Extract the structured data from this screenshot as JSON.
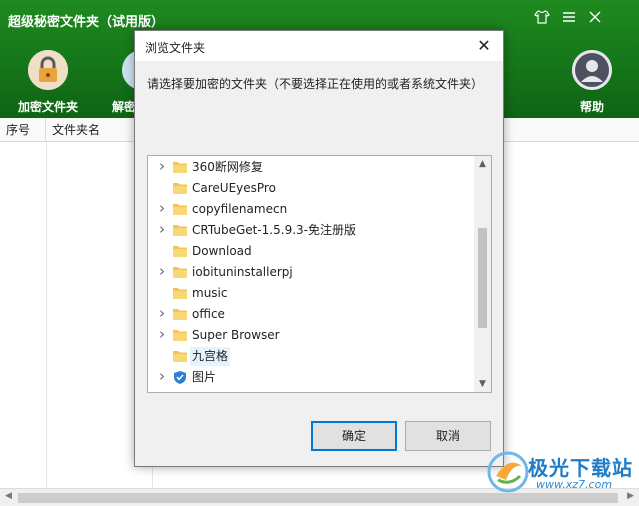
{
  "app": {
    "title": "超级秘密文件夹（试用版）",
    "toolbar": [
      {
        "label": "加密文件夹",
        "icon": "lock-icon"
      },
      {
        "label": "解密",
        "icon": "unlock-icon"
      },
      {
        "label": "帮助",
        "icon": "user-help-icon"
      }
    ],
    "window_controls": [
      "skin-icon",
      "menu-icon",
      "close-icon"
    ]
  },
  "table": {
    "columns": [
      "序号",
      "文件夹名"
    ]
  },
  "dialog": {
    "title": "浏览文件夹",
    "prompt": "请选择要加密的文件夹（不要选择正在使用的或者系统文件夹）",
    "ok_label": "确定",
    "cancel_label": "取消",
    "tree": [
      {
        "label": "360断网修复",
        "expandable": true
      },
      {
        "label": "CareUEyesPro",
        "expandable": false
      },
      {
        "label": "copyfilenamecn",
        "expandable": true
      },
      {
        "label": "CRTubeGet-1.5.9.3-免注册版",
        "expandable": true
      },
      {
        "label": "Download",
        "expandable": false
      },
      {
        "label": "iobituninstallerpj",
        "expandable": true
      },
      {
        "label": "music",
        "expandable": false
      },
      {
        "label": "office",
        "expandable": true
      },
      {
        "label": "Super Browser",
        "expandable": true
      },
      {
        "label": "九宫格",
        "expandable": false,
        "selected": true
      },
      {
        "label": "图片",
        "expandable": true,
        "special": true
      }
    ]
  },
  "watermark": {
    "text": "极光下载站",
    "url": "www.xz7.com"
  },
  "colors": {
    "header_green": "#15761a",
    "accent_blue": "#0078d7",
    "folder_yellow": "#f5c451"
  }
}
